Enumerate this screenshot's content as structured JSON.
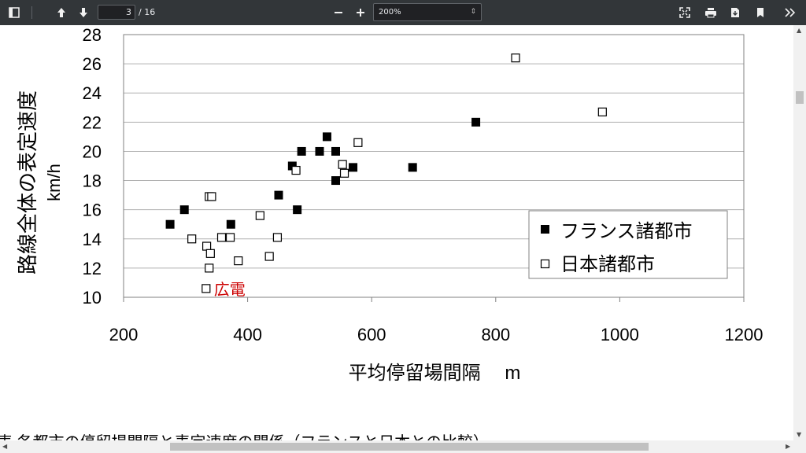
{
  "toolbar": {
    "page_value": "3",
    "page_total": "/ 16",
    "zoom": "200%"
  },
  "icons": [
    "sidebar-toggle-icon",
    "arrow-up-icon",
    "arrow-down-icon",
    "minus-icon",
    "plus-icon",
    "fit-page-icon",
    "print-icon",
    "save-icon",
    "bookmark-icon",
    "more-tools-icon"
  ],
  "chart_data": {
    "type": "scatter",
    "title": "",
    "xlabel": "平均停留場間隔　 m",
    "ylabel": "路線全体の表定速度",
    "ylabel_unit": "km/h",
    "xlim": [
      200,
      1200
    ],
    "ylim": [
      10,
      28
    ],
    "xticks": [
      "200",
      "400",
      "600",
      "800",
      "1000",
      "1200"
    ],
    "yticks": [
      "10",
      "12",
      "14",
      "16",
      "18",
      "20",
      "22",
      "24",
      "26",
      "28"
    ],
    "grid": "horizontal",
    "legend_position": "bottom-right",
    "series": [
      {
        "name": "フランス諸都市",
        "marker": "filled-square",
        "color": "#000000",
        "x": [
          275,
          298,
          373,
          450,
          480,
          487,
          472,
          516,
          528,
          542,
          542,
          570,
          666,
          768
        ],
        "y": [
          15.0,
          16.0,
          15.0,
          17.0,
          16.0,
          20.0,
          19.0,
          20.0,
          21.0,
          20.0,
          18.0,
          18.9,
          18.9,
          22.0
        ]
      },
      {
        "name": "日本諸都市",
        "marker": "open-square",
        "color": "#000000",
        "x": [
          310,
          334,
          338,
          340,
          338,
          342,
          358,
          372,
          385,
          420,
          435,
          448,
          478,
          553,
          556,
          578,
          832,
          972,
          333
        ],
        "y": [
          14.0,
          13.5,
          12.0,
          13.0,
          16.9,
          16.9,
          14.1,
          14.1,
          12.5,
          15.6,
          12.8,
          14.1,
          18.7,
          19.1,
          18.5,
          20.6,
          26.4,
          22.7,
          10.6
        ]
      }
    ],
    "annotations": [
      {
        "text": "広電",
        "x": 333,
        "y": 10.6,
        "color": "#cc0000"
      }
    ]
  },
  "caption_partial": "表 各都市の停留場間隔と表定速度の関係（フランスと日本との比較）"
}
